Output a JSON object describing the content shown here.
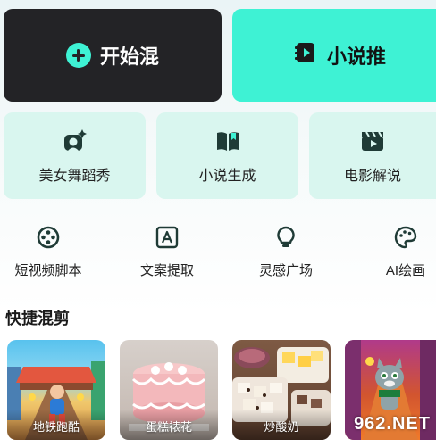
{
  "actions": {
    "mix_label": "开始混",
    "novel_push_label": "小说推"
  },
  "features": [
    {
      "label": "美女舞蹈秀",
      "icon": "selfie-sparkle-icon"
    },
    {
      "label": "小说生成",
      "icon": "book-icon"
    },
    {
      "label": "电影解说",
      "icon": "clapperboard-icon"
    }
  ],
  "tools": [
    {
      "label": "短视频脚本",
      "icon": "film-reel-icon"
    },
    {
      "label": "文案提取",
      "icon": "text-box-icon"
    },
    {
      "label": "灵感广场",
      "icon": "lightbulb-icon"
    },
    {
      "label": "AI绘画",
      "icon": "palette-icon"
    }
  ],
  "quick_mix": {
    "title": "快捷混剪",
    "items": [
      {
        "label": "地铁跑酷"
      },
      {
        "label": "蛋糕裱花"
      },
      {
        "label": "炒酸奶"
      },
      {
        "label": ""
      }
    ]
  },
  "colors": {
    "accent": "#3ef2d4",
    "dark_button": "#232326",
    "card_bg": "#d9f6ef",
    "icon_dark": "#1f3b36"
  }
}
